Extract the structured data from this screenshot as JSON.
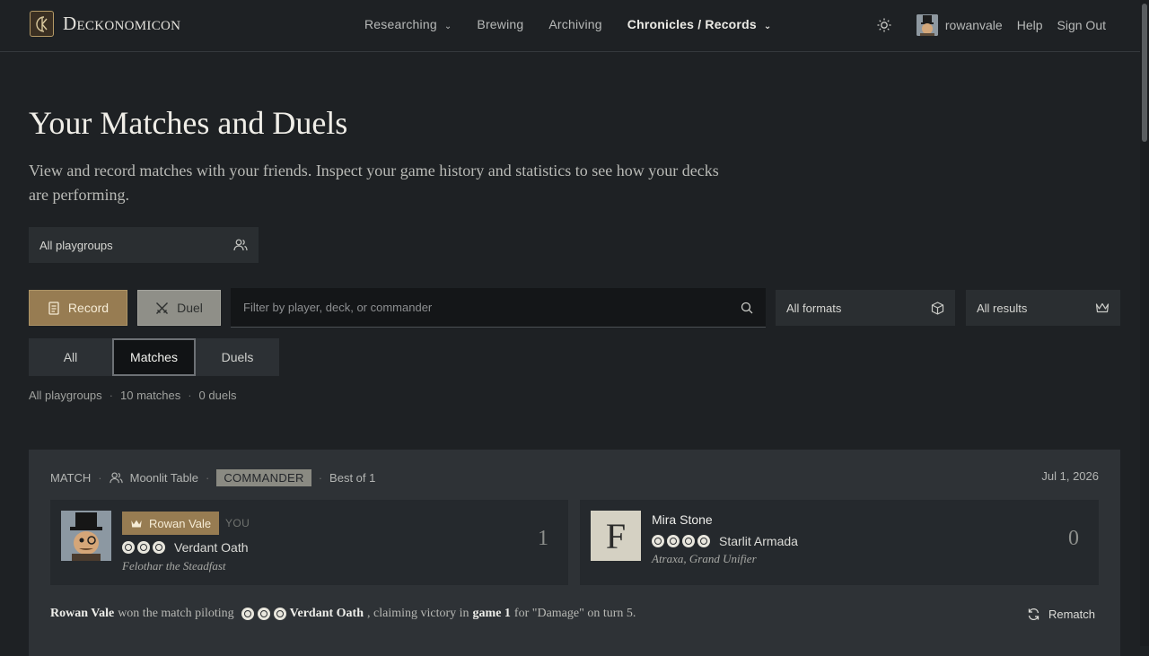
{
  "nav": {
    "brand": "Deckonomicon",
    "brand_mark": "CK",
    "links": [
      {
        "label": "Researching",
        "has_dropdown": true
      },
      {
        "label": "Brewing",
        "has_dropdown": false
      },
      {
        "label": "Archiving",
        "has_dropdown": false
      },
      {
        "label": "Chronicles / Records",
        "has_dropdown": true,
        "active": true
      }
    ],
    "username": "rowanvale",
    "help": "Help",
    "sign_out": "Sign Out"
  },
  "header": {
    "title": "Your Matches and Duels",
    "subtitle": "View and record matches with your friends. Inspect your game history and statistics to see how your decks are performing."
  },
  "playgroup_select": {
    "value": "All playgroups"
  },
  "toolbar": {
    "record_label": "Record",
    "duel_label": "Duel",
    "filter_placeholder": "Filter by player, deck, or commander",
    "formats_value": "All formats",
    "results_value": "All results"
  },
  "tabs": [
    {
      "label": "All",
      "active": false
    },
    {
      "label": "Matches",
      "active": true
    },
    {
      "label": "Duels",
      "active": false
    }
  ],
  "summary": {
    "playgroup": "All playgroups",
    "matches": "10 matches",
    "duels": "0 duels"
  },
  "match": {
    "kind": "MATCH",
    "table": "Moonlit Table",
    "format": "COMMANDER",
    "best_of": "Best of 1",
    "date": "Jul 1, 2026",
    "player1": {
      "name": "Rowan Vale",
      "you_label": "YOU",
      "deck": "Verdant Oath",
      "commander": "Felothar the Steadfast",
      "score": "1",
      "mana": [
        "white",
        "black",
        "green"
      ]
    },
    "player2": {
      "name": "Mira Stone",
      "avatar_letter": "F",
      "deck": "Starlit Armada",
      "commander": "Atraxa, Grand Unifier",
      "score": "0",
      "mana": [
        "white",
        "blue",
        "black",
        "green"
      ]
    },
    "result": {
      "winner": "Rowan Vale",
      "text1": "won the match piloting",
      "deck": "Verdant Oath",
      "text2": ", claiming victory in",
      "game": "game 1",
      "text3": "for \"Damage\" on turn 5."
    },
    "rematch_label": "Rematch"
  },
  "colors": {
    "accent": "#977c52",
    "background": "#1e2124",
    "card": "#2e3236"
  }
}
